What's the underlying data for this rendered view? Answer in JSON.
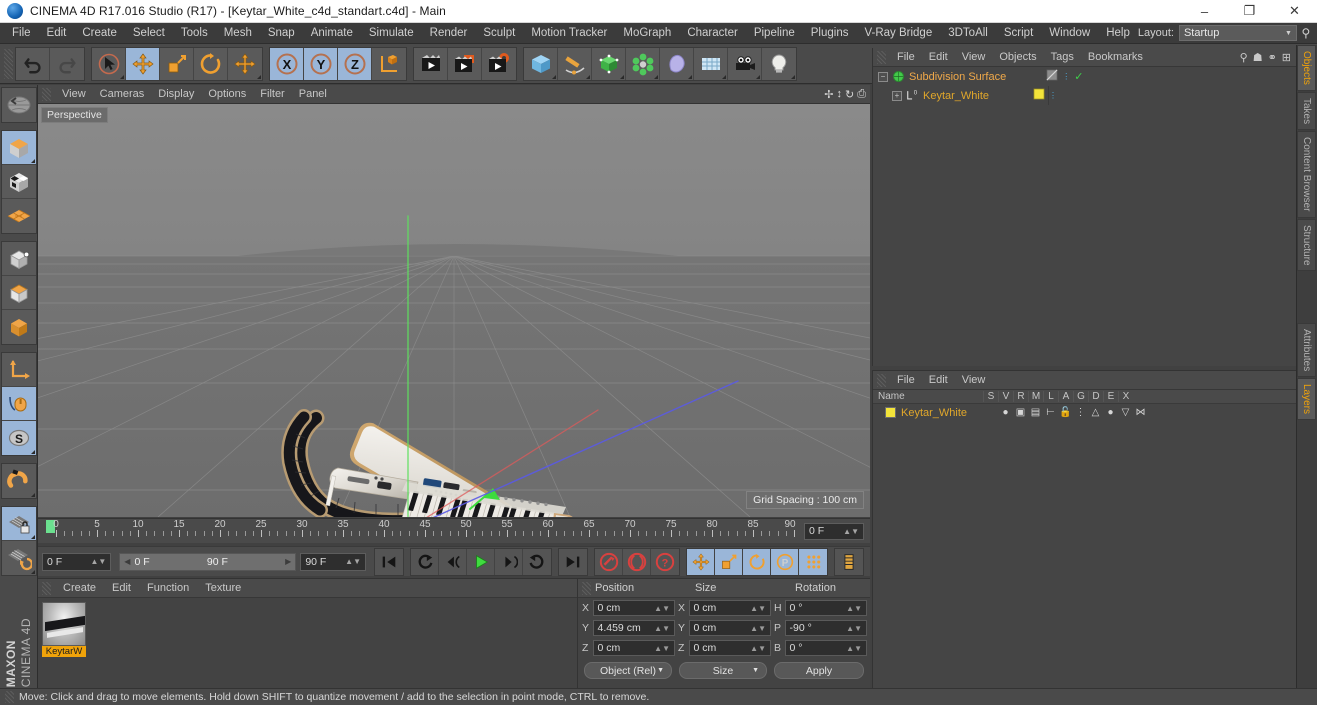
{
  "window": {
    "title": "CINEMA 4D R17.016 Studio (R17) - [Keytar_White_c4d_standart.c4d] - Main",
    "app_icon": "cinema4d-logo-icon",
    "minimize": "–",
    "maximize": "❐",
    "close": "✕"
  },
  "menubar": {
    "items": [
      "File",
      "Edit",
      "Create",
      "Select",
      "Tools",
      "Mesh",
      "Snap",
      "Animate",
      "Simulate",
      "Render",
      "Sculpt",
      "Motion Tracker",
      "MoGraph",
      "Character",
      "Pipeline",
      "Plugins",
      "V-Ray Bridge",
      "3DToAll",
      "Script",
      "Window",
      "Help"
    ],
    "layout_label": "Layout:",
    "layout_value": "Startup",
    "search_icon": "search-icon"
  },
  "toolbar": {
    "groups": [
      {
        "name": "undo-redo",
        "buttons": [
          {
            "icon": "undo-icon",
            "active": false
          },
          {
            "icon": "redo-icon",
            "active": false
          }
        ]
      },
      {
        "name": "transform-tools",
        "buttons": [
          {
            "icon": "live-selection-icon",
            "active": false
          },
          {
            "icon": "move-icon",
            "active": true
          },
          {
            "icon": "scale-icon",
            "active": false
          },
          {
            "icon": "rotate-icon",
            "active": false
          },
          {
            "icon": "move-alt-icon",
            "active": false
          }
        ]
      },
      {
        "name": "axis-locks",
        "buttons": [
          {
            "icon": "x-axis-icon",
            "active": true
          },
          {
            "icon": "y-axis-icon",
            "active": true
          },
          {
            "icon": "z-axis-icon",
            "active": true
          },
          {
            "icon": "world-object-axis-icon",
            "active": false
          }
        ]
      },
      {
        "name": "render-tools",
        "buttons": [
          {
            "icon": "render-view-icon",
            "active": false
          },
          {
            "icon": "render-region-icon",
            "active": false
          },
          {
            "icon": "render-settings-icon",
            "active": false
          }
        ]
      },
      {
        "name": "create-objects",
        "buttons": [
          {
            "icon": "cube-primitive-icon",
            "active": false
          },
          {
            "icon": "spline-pen-icon",
            "active": false
          },
          {
            "icon": "generator-nurbs-icon",
            "active": false
          },
          {
            "icon": "array-object-icon",
            "active": false
          },
          {
            "icon": "deformer-bend-icon",
            "active": false
          },
          {
            "icon": "floor-environment-icon",
            "active": false
          },
          {
            "icon": "camera-icon",
            "active": false
          },
          {
            "icon": "light-icon",
            "active": false
          }
        ]
      }
    ]
  },
  "left_toolbar": {
    "groups": [
      {
        "buttons": [
          {
            "icon": "undo-view-icon",
            "active": false
          }
        ]
      },
      {
        "buttons": [
          {
            "icon": "model-mode-icon",
            "active": true
          },
          {
            "icon": "texture-mode-icon",
            "active": false
          },
          {
            "icon": "polygon-mode-icon",
            "active": false
          }
        ]
      },
      {
        "buttons": [
          {
            "icon": "point-mode-icon",
            "active": false
          },
          {
            "icon": "edge-mode-icon",
            "active": false
          },
          {
            "icon": "polygon-face-mode-icon",
            "active": false
          }
        ]
      },
      {
        "buttons": [
          {
            "icon": "axis-modify-icon",
            "active": false
          },
          {
            "icon": "viewport-solo-icon",
            "active": true
          },
          {
            "icon": "soft-selection-icon",
            "active": true
          }
        ]
      },
      {
        "buttons": [
          {
            "icon": "snap-magnet-icon",
            "active": false
          }
        ]
      },
      {
        "buttons": [
          {
            "icon": "lock-workplane-icon",
            "active": true
          },
          {
            "icon": "workplane-icon",
            "active": false
          }
        ]
      }
    ],
    "brand_top": "MAXON",
    "brand_bottom": "CINEMA 4D"
  },
  "viewport": {
    "menu": [
      "View",
      "Cameras",
      "Display",
      "Options",
      "Filter",
      "Panel"
    ],
    "nav_icons": [
      "pan-icon",
      "dolly-icon",
      "rotate-view-icon",
      "maximize-view-icon"
    ],
    "label": "Perspective",
    "grid_spacing": "Grid Spacing : 100 cm",
    "axis_gizmo": {
      "x": "X",
      "y": "Y",
      "z": "Z"
    },
    "scene_object": "white-keytar-keyboard-with-black-strap"
  },
  "timeline": {
    "ticks": [
      0,
      5,
      10,
      15,
      20,
      25,
      30,
      35,
      40,
      45,
      50,
      55,
      60,
      65,
      70,
      75,
      80,
      85,
      90
    ],
    "current_frame": "0 F"
  },
  "playbar": {
    "start_field": "0 F",
    "range_start": "0 F",
    "range_end": "90 F",
    "end_field": "90 F",
    "buttons": [
      {
        "icon": "go-to-start-icon",
        "active": false
      },
      {
        "icon": "play-reverse-loop-icon",
        "active": false
      },
      {
        "icon": "step-back-icon",
        "active": false
      },
      {
        "icon": "play-icon",
        "active": false
      },
      {
        "icon": "step-forward-icon",
        "active": false
      },
      {
        "icon": "loop-icon",
        "active": false
      },
      {
        "icon": "go-to-end-icon",
        "active": false
      },
      {
        "icon": "record-icon",
        "active": false
      },
      {
        "icon": "autokey-icon",
        "active": false
      },
      {
        "icon": "keyframe-selection-icon",
        "active": false
      },
      {
        "icon": "key-position-icon",
        "active": true
      },
      {
        "icon": "key-scale-icon",
        "active": true
      },
      {
        "icon": "key-rotation-icon",
        "active": true
      },
      {
        "icon": "key-parameter-icon",
        "active": true
      },
      {
        "icon": "key-pla-icon",
        "active": true
      },
      {
        "icon": "timeline-view-icon",
        "active": false
      }
    ]
  },
  "material_manager": {
    "menu": [
      "Create",
      "Edit",
      "Function",
      "Texture"
    ],
    "materials": [
      {
        "name": "KeytarW",
        "thumbnail": "keytar-white-material-thumbnail"
      }
    ]
  },
  "coordinates": {
    "columns": [
      "Position",
      "Size",
      "Rotation"
    ],
    "rows": [
      {
        "pos_axis": "X",
        "pos_value": "0 cm",
        "size_axis": "X",
        "size_value": "0 cm",
        "rot_axis": "H",
        "rot_value": "0 °"
      },
      {
        "pos_axis": "Y",
        "pos_value": "4.459 cm",
        "size_axis": "Y",
        "size_value": "0 cm",
        "rot_axis": "P",
        "rot_value": "-90 °"
      },
      {
        "pos_axis": "Z",
        "pos_value": "0 cm",
        "size_axis": "Z",
        "size_value": "0 cm",
        "rot_axis": "B",
        "rot_value": "0 °"
      }
    ],
    "mode_dropdown": "Object (Rel)",
    "size_dropdown": "Size",
    "apply_button": "Apply"
  },
  "object_manager": {
    "menu": [
      "File",
      "Edit",
      "View",
      "Objects",
      "Tags",
      "Bookmarks"
    ],
    "header_icons": [
      "search-icon",
      "home-icon",
      "link-icon",
      "fit-icon"
    ],
    "rows": [
      {
        "name": "Subdivision Surface",
        "icon": "subdivision-surface-icon",
        "indent": 0,
        "selected": true,
        "tags": [
          "texture-tag",
          "dots-icon",
          "checkmark-icon"
        ]
      },
      {
        "name": "Keytar_White",
        "icon": "null-object-icon",
        "indent": 1,
        "selected": false,
        "tags": [
          "yellow-material-tag",
          "dots-icon"
        ]
      }
    ]
  },
  "layer_manager": {
    "menu": [
      "File",
      "Edit",
      "View"
    ],
    "columns": [
      "Name",
      "S",
      "V",
      "R",
      "M",
      "L",
      "A",
      "G",
      "D",
      "E",
      "X"
    ],
    "rows": [
      {
        "name": "Keytar_White",
        "color": "#f3e43a",
        "icons": [
          "solo-dot-icon",
          "visible-icon",
          "render-icon",
          "manager-icon",
          "lock-open-icon",
          "animation-icon",
          "generator-icon",
          "deformer-icon",
          "expression-icon",
          "xpresso-icon"
        ]
      }
    ]
  },
  "vertical_tabs": [
    {
      "label": "Objects",
      "active": true
    },
    {
      "label": "Takes",
      "active": false
    },
    {
      "label": "Content Browser",
      "active": false
    },
    {
      "label": "Structure",
      "active": false
    },
    {
      "label": "Attributes",
      "active": false
    },
    {
      "label": "Layers",
      "active": true
    }
  ],
  "statusbar": {
    "text": "Move: Click and drag to move elements. Hold down SHIFT to quantize movement / add to the selection in point mode, CTRL to remove."
  },
  "colors": {
    "accent_orange": "#f0a30a",
    "panel_bg": "#454545",
    "toolbar_bg": "#4a4a4a",
    "active_blue": "#9ab6d8",
    "axis_x_red": "#d84b4b",
    "axis_y_green": "#4bd84b",
    "axis_z_blue": "#4b4bd8"
  }
}
